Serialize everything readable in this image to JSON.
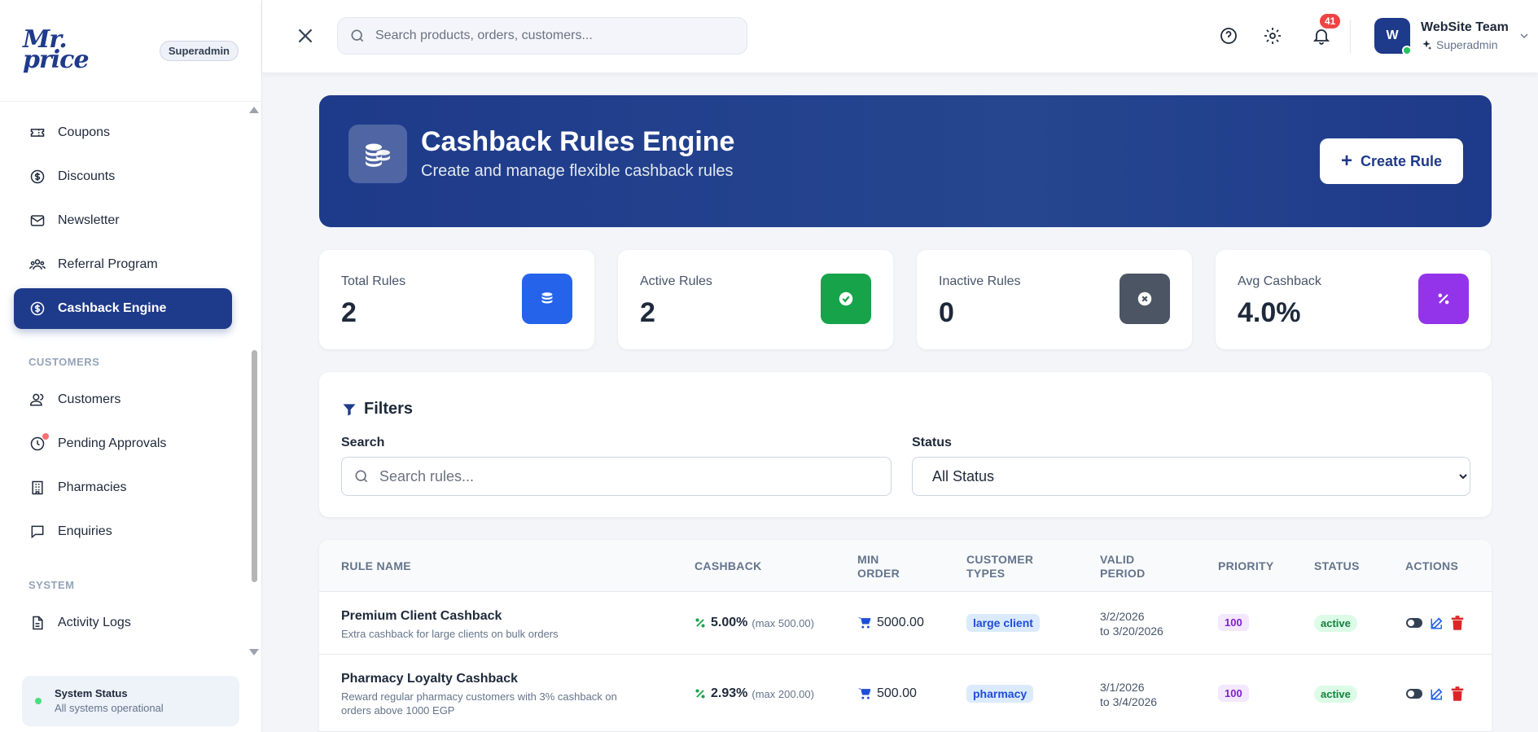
{
  "sidebar": {
    "logo": "Mr.\nprice",
    "role_badge": "Superadmin",
    "items": [
      {
        "label": "Coupons",
        "icon": "ticket-icon"
      },
      {
        "label": "Discounts",
        "icon": "dollar-circle-icon"
      },
      {
        "label": "Newsletter",
        "icon": "mail-icon"
      },
      {
        "label": "Referral Program",
        "icon": "users-icon"
      },
      {
        "label": "Cashback Engine",
        "icon": "dollar-circle-icon",
        "active": true
      }
    ],
    "section_customers": "CUSTOMERS",
    "customer_items": [
      {
        "label": "Customers",
        "icon": "user-group-icon"
      },
      {
        "label": "Pending Approvals",
        "icon": "clock-icon"
      },
      {
        "label": "Pharmacies",
        "icon": "building-icon"
      },
      {
        "label": "Enquiries",
        "icon": "chat-icon"
      }
    ],
    "section_system": "SYSTEM",
    "system_items": [
      {
        "label": "Activity Logs",
        "icon": "document-icon"
      }
    ],
    "system_status": {
      "title": "System Status",
      "text": "All systems operational"
    }
  },
  "header": {
    "search_placeholder": "Search products, orders, customers...",
    "notification_count": "41",
    "user_initial": "W",
    "user_name": "WebSite Team",
    "user_role": "Superadmin"
  },
  "hero": {
    "title": "Cashback Rules Engine",
    "subtitle": "Create and manage flexible cashback rules",
    "create_label": "Create Rule"
  },
  "stats": [
    {
      "label": "Total Rules",
      "value": "2",
      "color": "#2563eb"
    },
    {
      "label": "Active Rules",
      "value": "2",
      "color": "#16a34a"
    },
    {
      "label": "Inactive Rules",
      "value": "0",
      "color": "#4b5563"
    },
    {
      "label": "Avg Cashback",
      "value": "4.0%",
      "color": "#9333ea"
    }
  ],
  "filters": {
    "title": "Filters",
    "search_label": "Search",
    "search_placeholder": "Search rules...",
    "status_label": "Status",
    "status_value": "All Status"
  },
  "table": {
    "headers": {
      "rule_name": "RULE NAME",
      "cashback": "CASHBACK",
      "min_order_1": "MIN",
      "min_order_2": "ORDER",
      "customer_types_1": "CUSTOMER",
      "customer_types_2": "TYPES",
      "valid_period_1": "VALID",
      "valid_period_2": "PERIOD",
      "priority": "PRIORITY",
      "status": "STATUS",
      "actions": "ACTIONS"
    },
    "rows": [
      {
        "name": "Premium Client Cashback",
        "description": "Extra cashback for large clients on bulk orders",
        "cashback": "5.00%",
        "cashback_max": "(max 500.00)",
        "min_order": "5000.00",
        "customer_type": "large client",
        "valid_from": "3/2/2026",
        "valid_to": "to 3/20/2026",
        "priority": "100",
        "status": "active"
      },
      {
        "name": "Pharmacy Loyalty Cashback",
        "description": "Reward regular pharmacy customers with 3% cashback on orders above 1000 EGP",
        "cashback": "2.93%",
        "cashback_max": "(max 200.00)",
        "min_order": "500.00",
        "customer_type": "pharmacy",
        "valid_from": "3/1/2026",
        "valid_to": "to 3/4/2026",
        "priority": "100",
        "status": "active"
      }
    ]
  }
}
